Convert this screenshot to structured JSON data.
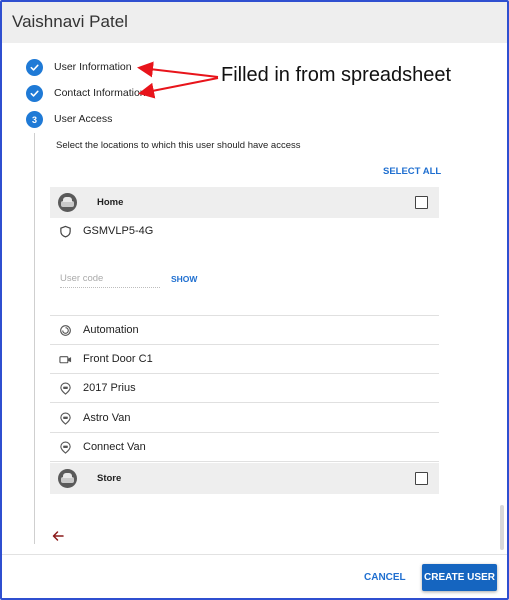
{
  "header": {
    "title": "Vaishnavi Patel"
  },
  "steps": [
    {
      "label": "User Information",
      "state": "complete",
      "number": ""
    },
    {
      "label": "Contact Information",
      "state": "complete",
      "number": ""
    },
    {
      "label": "User Access",
      "state": "active",
      "number": "3"
    }
  ],
  "annotation": {
    "text": "Filled in from spreadsheet",
    "color": "#e8141b"
  },
  "access": {
    "instruction": "Select the locations to which this user should have access",
    "select_all_label": "SELECT ALL",
    "locations": [
      {
        "name": "Home",
        "checked": false,
        "gsm_device": "GSMVLP5-4G",
        "user_code_placeholder": "User code",
        "user_code_value": "",
        "show_label": "SHOW",
        "devices": [
          {
            "name": "Automation",
            "icon": "automation-icon"
          },
          {
            "name": "Front Door C1",
            "icon": "camera-icon"
          },
          {
            "name": "2017 Prius",
            "icon": "vehicle-pin-icon"
          },
          {
            "name": "Astro Van",
            "icon": "vehicle-pin-icon"
          },
          {
            "name": "Connect Van",
            "icon": "vehicle-pin-icon"
          }
        ]
      },
      {
        "name": "Store",
        "checked": false
      }
    ]
  },
  "footer": {
    "cancel_label": "CANCEL",
    "create_label": "CREATE USER"
  },
  "colors": {
    "accent": "#1f6fd0",
    "step": "#1f7ad6",
    "primary_button": "#1565c0",
    "frame": "#2f4fd0"
  }
}
